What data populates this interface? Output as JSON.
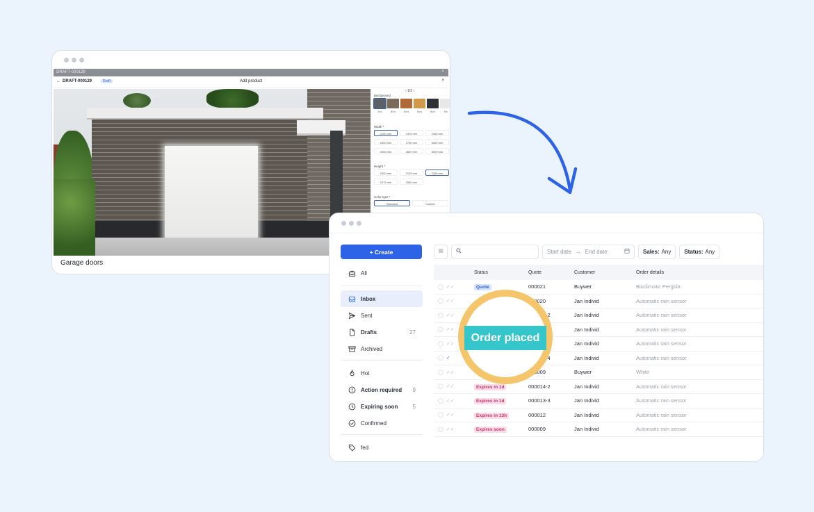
{
  "product_window": {
    "back_draft": "DRAFT-000129",
    "draft_id": "DRAFT-000129",
    "draft_badge": "Draft",
    "modal_title": "Add product",
    "close": "×",
    "caption": "Garage doors",
    "panel": {
      "pager": "‹ 1/3 ›",
      "background_label": "Background",
      "swatches": [
        {
          "label": "Arrc",
          "color": "#5c6168"
        },
        {
          "label": "Bkrd",
          "color": "#7a6a5a"
        },
        {
          "label": "Bkrd",
          "color": "#b06a3a"
        },
        {
          "label": "Bkrd",
          "color": "#d09a4a"
        },
        {
          "label": "Bkrk",
          "color": "#2e3136"
        },
        {
          "label": "Brk",
          "color": "#e8e8e8"
        }
      ],
      "width_label": "Width *",
      "width_options": [
        "2250 mm",
        "2375 mm",
        "2450 mm",
        "2500 mm",
        "2750 mm",
        "3000 mm",
        "4000 mm",
        "4500 mm",
        "5000 mm"
      ],
      "height_label": "Height *",
      "height_options": [
        "2000 mm",
        "2125 mm",
        "2250 mm",
        "2375 mm",
        "2500 mm"
      ],
      "color_type_label": "Color type *",
      "color_types": [
        "Standard",
        "Custom"
      ]
    }
  },
  "orders_window": {
    "create_label": "+ Create",
    "nav": [
      {
        "label": "All",
        "icon": "inbox-stack-icon",
        "count": ""
      },
      {
        "label": "Inbox",
        "icon": "inbox-icon",
        "count": ""
      },
      {
        "label": "Sent",
        "icon": "send-icon",
        "count": ""
      },
      {
        "label": "Drafts",
        "icon": "file-icon",
        "count": "27"
      },
      {
        "label": "Archived",
        "icon": "archive-icon",
        "count": ""
      },
      {
        "label": "Hot",
        "icon": "fire-icon",
        "count": ""
      },
      {
        "label": "Action required",
        "icon": "alert-circle-icon",
        "count": "9"
      },
      {
        "label": "Expiring soon",
        "icon": "clock-icon",
        "count": "5"
      },
      {
        "label": "Confirmed",
        "icon": "check-circle-icon",
        "count": ""
      },
      {
        "label": "fed",
        "icon": "tag-icon",
        "count": ""
      }
    ],
    "toolbar": {
      "search_placeholder": "",
      "start_date": "Start date",
      "arrow": "→",
      "end_date": "End date",
      "sales_label": "Sales:",
      "sales_value": "Any",
      "status_label": "Status:",
      "status_value": "Any"
    },
    "columns": [
      "Status",
      "Quote",
      "Customer",
      "Order details"
    ],
    "rows": [
      {
        "status": "Quote",
        "kind": "quote",
        "quote": "000021",
        "customer": "Buywer",
        "details": "Bioclimatic Pergola",
        "checked": false
      },
      {
        "status": "",
        "kind": "",
        "quote": "000020",
        "customer": "Jan Individ",
        "details": "Automatic rain sensor",
        "checked": false
      },
      {
        "status": "",
        "kind": "",
        "quote": "000018-2",
        "customer": "Jan Individ",
        "details": "Automatic rain sensor",
        "checked": false
      },
      {
        "status": "",
        "kind": "",
        "quote": "000012-5",
        "customer": "Jan Individ",
        "details": "Automatic rain sensor",
        "checked": false
      },
      {
        "status": "",
        "kind": "",
        "quote": "000011-2",
        "customer": "Jan Individ",
        "details": "Automatic rain sensor",
        "checked": false
      },
      {
        "status": "",
        "kind": "",
        "quote": "000010-4",
        "customer": "Jan Individ",
        "details": "Automatic rain sensor",
        "checked": true
      },
      {
        "status": "",
        "kind": "",
        "quote": "000009",
        "customer": "Buywer",
        "details": "White",
        "checked": false
      },
      {
        "status": "Expires in 1d",
        "kind": "expire",
        "quote": "000014-2",
        "customer": "Jan Individ",
        "details": "Automatic rain sensor",
        "checked": false
      },
      {
        "status": "Expires in 1d",
        "kind": "expire",
        "quote": "000013-3",
        "customer": "Jan Individ",
        "details": "Automatic rain sensor",
        "checked": false
      },
      {
        "status": "Expires in 13h",
        "kind": "expire",
        "quote": "000012",
        "customer": "Jan Individ",
        "details": "Automatic rain sensor",
        "checked": false
      },
      {
        "status": "Expires soon",
        "kind": "expire",
        "quote": "000009",
        "customer": "Jan Individ",
        "details": "Automatic rain sensor",
        "checked": false
      }
    ],
    "highlight": "Order placed"
  },
  "colors": {
    "accent": "#2d63e6",
    "highlight_ring": "#f4c56a",
    "highlight_banner": "#35c6cb",
    "arrow": "#2d63e6"
  }
}
